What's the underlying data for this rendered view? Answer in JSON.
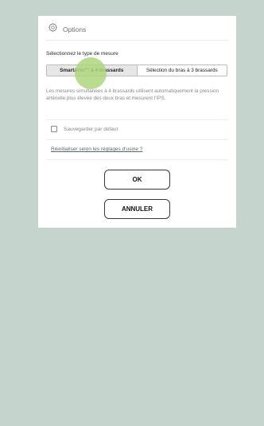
{
  "header": {
    "title": "Options",
    "icon": "gear-icon"
  },
  "mode": {
    "label": "Sélectionnez le type de mesure",
    "options": [
      "SmartArm™ à 4 brassards",
      "Sélection du bras à 3 brassards"
    ],
    "selected_index": 0
  },
  "description": "Les mesures simultanées à 4 brassards utilisent automatiquement la pression artérielle plus élevée des deux bras et mesurent l'IPS.",
  "save_default": {
    "label": "Sauvegarder par défaut",
    "checked": false
  },
  "reset_link": "Réinitialiser selon les réglages d'usine ?",
  "buttons": {
    "ok": "OK",
    "cancel": "ANNULER"
  },
  "colors": {
    "background": "#c5d4cd",
    "tap_indicator": "#aed67c"
  }
}
